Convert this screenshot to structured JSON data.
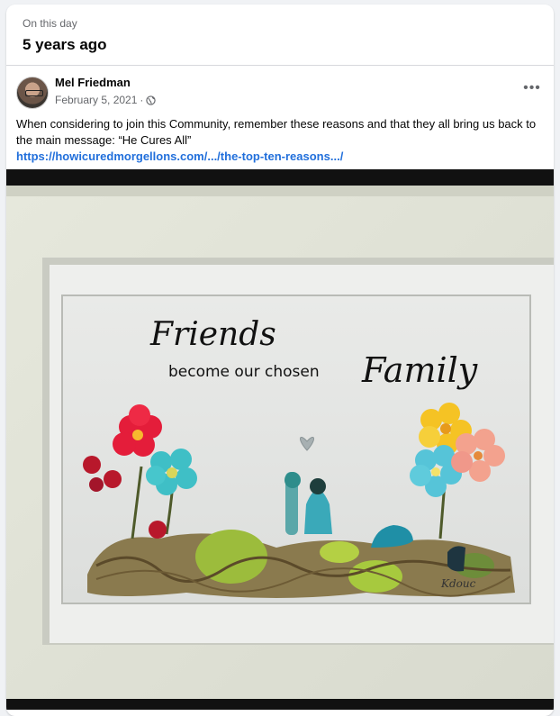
{
  "memory": {
    "label": "On this day",
    "title": "5 years ago"
  },
  "post": {
    "author": "Mel Friedman",
    "date": "February 5, 2021",
    "separator": "·",
    "privacy_icon": "globe-icon",
    "more_icon": "more-horizontal-icon",
    "more_label": "•••",
    "text": "When considering to join this Community, remember these reasons and that they all bring us back to the main message: “He Cures All”",
    "link": "https://howicuredmorgellons.com/.../the-top-ten-reasons.../"
  },
  "photo": {
    "line1": "Friends",
    "line2": "become our chosen",
    "line3": "Family",
    "signature": "Kdouc"
  },
  "colors": {
    "link": "#216fdb",
    "secondary_text": "#65676b",
    "divider": "#d6d8dc"
  }
}
